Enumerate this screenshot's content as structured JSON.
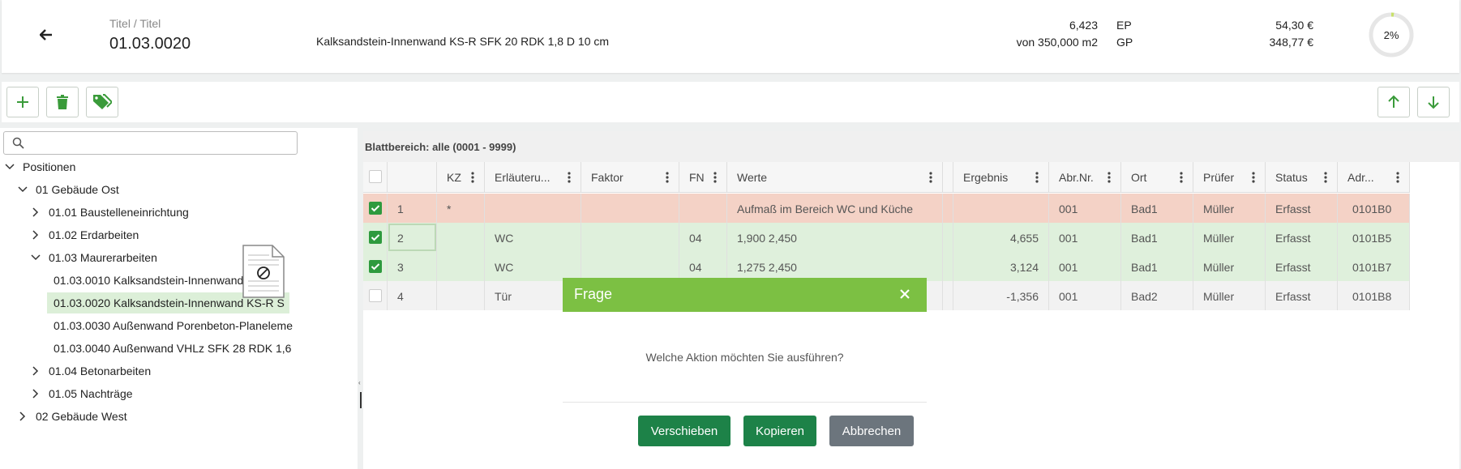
{
  "header": {
    "label": "Titel / Titel",
    "number": "01.03.0020",
    "description": "Kalksandstein-Innenwand KS-R SFK 20 RDK 1,8 D 10 cm",
    "quantity": "6,423",
    "quantity_total": "von 350,000 m2",
    "ep_label": "EP",
    "gp_label": "GP",
    "ep_value": "54,30 €",
    "gp_value": "348,77 €",
    "progress_text": "2%",
    "progress_value": 0.02
  },
  "toolbar": {
    "add_icon": "plus-icon",
    "delete_icon": "trash-icon",
    "tags_icon": "tags-icon",
    "up_icon": "arrow-up-icon",
    "down_icon": "arrow-down-icon"
  },
  "tree": {
    "search_placeholder": "",
    "items": [
      {
        "label": "Positionen",
        "chev": "down"
      },
      {
        "label": "01 Gebäude Ost",
        "chev": "down"
      },
      {
        "label": "01.01 Baustelleneinrichtung",
        "chev": "right"
      },
      {
        "label": "01.02 Erdarbeiten",
        "chev": "right"
      },
      {
        "label": "01.03 Maurerarbeiten",
        "chev": "down"
      },
      {
        "label": "01.03.0010 Kalksandstein-Innenwand KS-R S",
        "chev": ""
      },
      {
        "label": "01.03.0020 Kalksandstein-Innenwand KS-R S",
        "chev": ""
      },
      {
        "label": "01.03.0030 Außenwand Porenbeton-Planeleme",
        "chev": ""
      },
      {
        "label": "01.03.0040 Außenwand VHLz SFK 28 RDK 1,6",
        "chev": ""
      },
      {
        "label": "01.04 Betonarbeiten",
        "chev": "right"
      },
      {
        "label": "01.05 Nachträge",
        "chev": "right"
      },
      {
        "label": "02 Gebäude West",
        "chev": "right"
      }
    ]
  },
  "grid": {
    "caption": "Blattbereich: alle (0001 - 9999)",
    "columns": [
      "",
      "",
      "KZ",
      "Erläuteru...",
      "Faktor",
      "FN",
      "Werte",
      "",
      "Ergebnis",
      "Abr.Nr.",
      "Ort",
      "Prüfer",
      "Status",
      "Adr..."
    ],
    "rows": [
      {
        "n": "1",
        "kz": "*",
        "erl": "",
        "faktor": "",
        "fn": "",
        "werte": "Aufmaß im Bereich WC und Küche",
        "ergebnis": "",
        "abr": "001",
        "ort": "Bad1",
        "pruefer": "Müller",
        "status": "Erfasst",
        "adr": "0101B0"
      },
      {
        "n": "2",
        "kz": "",
        "erl": "WC",
        "faktor": "",
        "fn": "04",
        "werte": "1,900 2,450",
        "ergebnis": "4,655",
        "abr": "001",
        "ort": "Bad1",
        "pruefer": "Müller",
        "status": "Erfasst",
        "adr": "0101B5"
      },
      {
        "n": "3",
        "kz": "",
        "erl": "WC",
        "faktor": "",
        "fn": "04",
        "werte": "1,275 2,450",
        "ergebnis": "3,124",
        "abr": "001",
        "ort": "Bad1",
        "pruefer": "Müller",
        "status": "Erfasst",
        "adr": "0101B7"
      },
      {
        "n": "4",
        "kz": "",
        "erl": "Tür",
        "faktor": "",
        "fn": "",
        "werte": "",
        "ergebnis": "-1,356",
        "abr": "001",
        "ort": "Bad2",
        "pruefer": "Müller",
        "status": "Erfasst",
        "adr": "0101B8"
      }
    ]
  },
  "dialog": {
    "title": "Frage",
    "message": "Welche Aktion möchten Sie ausführen?",
    "btn_move": "Verschieben",
    "btn_copy": "Kopieren",
    "btn_cancel": "Abbrechen"
  },
  "colors": {
    "accent": "#7cc043",
    "button_green": "#1d8248",
    "row_highlight_red": "#f4d2c6",
    "row_highlight_green": "#dff0dc"
  }
}
